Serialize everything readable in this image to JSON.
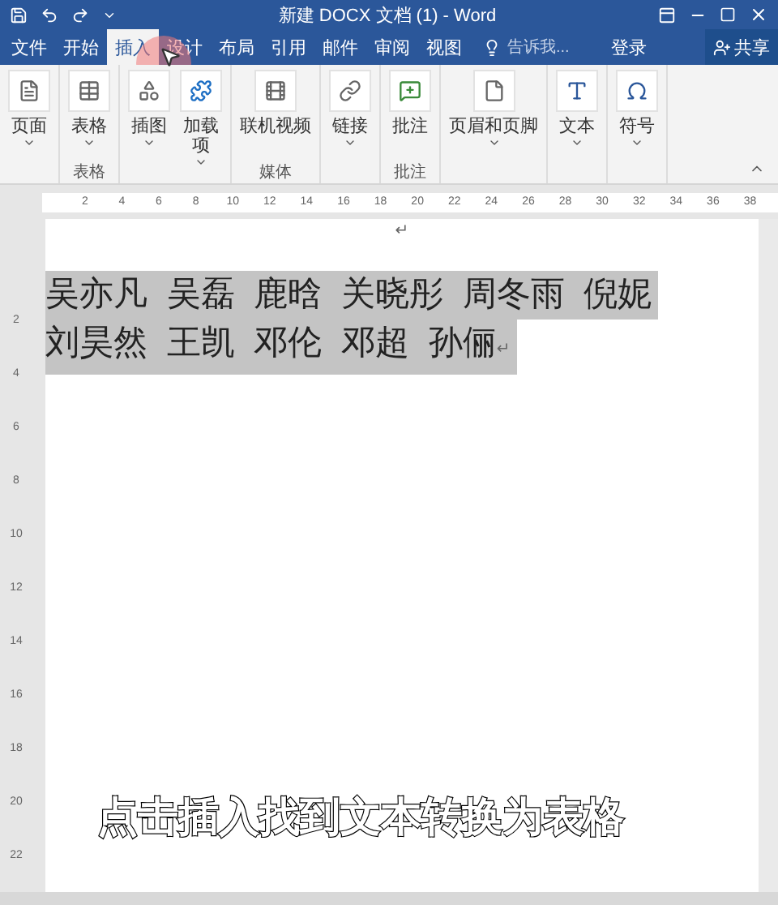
{
  "window": {
    "title": "新建 DOCX 文档 (1) - Word"
  },
  "tabs": [
    {
      "label": "文件",
      "selected": false
    },
    {
      "label": "开始",
      "selected": false
    },
    {
      "label": "插入",
      "selected": true
    },
    {
      "label": "设计",
      "selected": false
    },
    {
      "label": "布局",
      "selected": false
    },
    {
      "label": "引用",
      "selected": false
    },
    {
      "label": "邮件",
      "selected": false
    },
    {
      "label": "审阅",
      "selected": false
    },
    {
      "label": "视图",
      "selected": false
    }
  ],
  "tell_me": {
    "placeholder": "告诉我..."
  },
  "sign_in": "登录",
  "share": "共享",
  "ribbon": [
    {
      "items": [
        {
          "label": "页面",
          "dropdown": true
        }
      ]
    },
    {
      "label": "表格",
      "items": [
        {
          "label": "表格",
          "dropdown": true
        }
      ]
    },
    {
      "items": [
        {
          "label": "插图",
          "dropdown": true
        },
        {
          "label": "加载项",
          "dropdown": true
        }
      ]
    },
    {
      "label": "媒体",
      "items": [
        {
          "label": "联机视频",
          "dropdown": false
        }
      ]
    },
    {
      "items": [
        {
          "label": "链接",
          "dropdown": true
        }
      ]
    },
    {
      "label": "批注",
      "items": [
        {
          "label": "批注",
          "dropdown": false
        }
      ]
    },
    {
      "items": [
        {
          "label": "页眉和页脚",
          "dropdown": true
        }
      ]
    },
    {
      "items": [
        {
          "label": "文本",
          "dropdown": true
        }
      ]
    },
    {
      "items": [
        {
          "label": "符号",
          "dropdown": true
        }
      ]
    }
  ],
  "ruler": {
    "ticks": [
      "2",
      "4",
      "6",
      "8",
      "10",
      "12",
      "14",
      "16",
      "18",
      "20",
      "22",
      "24",
      "26",
      "28",
      "30",
      "32",
      "34",
      "36",
      "38"
    ]
  },
  "vertical_ruler": {
    "ticks": [
      "2",
      "4",
      "6",
      "8",
      "10",
      "12",
      "14",
      "16",
      "18",
      "20",
      "22"
    ]
  },
  "document": {
    "empty_mark": "↵",
    "paragraph": {
      "selected": true,
      "lines": [
        "吴亦凡 吴磊 鹿晗 关晓彤 周冬雨 倪妮",
        "刘昊然 王凯 邓伦 邓超 孙俪"
      ],
      "mark": "↵"
    }
  },
  "subtitle": "点击插入找到文本转换为表格"
}
